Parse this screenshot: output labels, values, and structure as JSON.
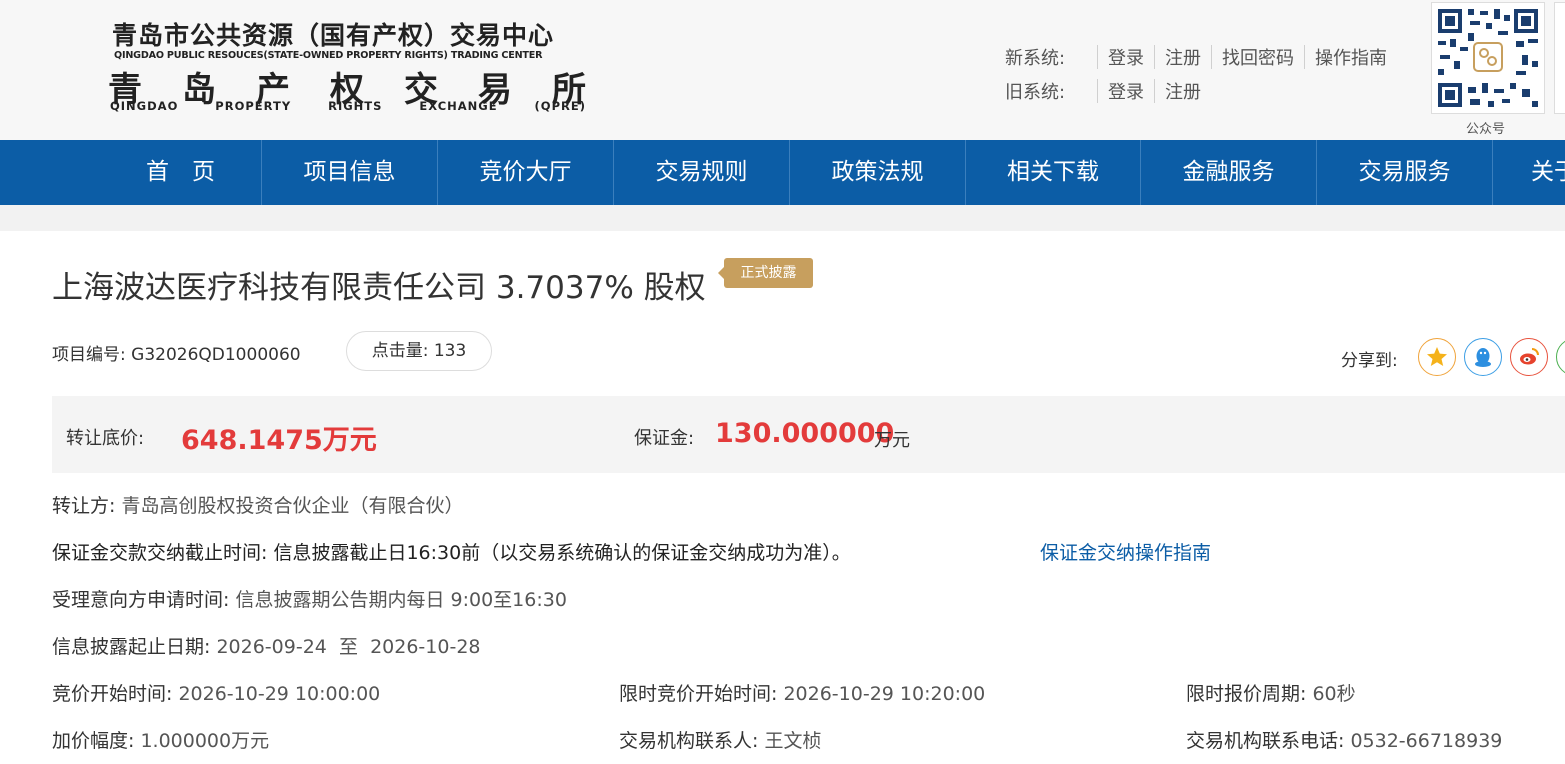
{
  "header": {
    "logo": {
      "name_zh": "青岛市公共资源（国有产权）交易中心",
      "name_en": "QINGDAO PUBLIC RESOUCES(STATE-OWNED PROPERTY RIGHTS) TRADING CENTER",
      "exchange_zh": [
        "青",
        "岛",
        "产",
        "权",
        "交",
        "易",
        "所"
      ],
      "exchange_en": [
        "QINGDAO",
        "PROPERTY",
        "RIGHTS",
        "EXCHANGE",
        "(QPRE)"
      ]
    },
    "new_system": {
      "label": "新系统:",
      "links": [
        "登录",
        "注册",
        "找回密码",
        "操作指南"
      ]
    },
    "old_system": {
      "label": "旧系统:",
      "links": [
        "登录",
        "注册"
      ]
    },
    "qr_caption": "公众号"
  },
  "nav": {
    "items": [
      "首　页",
      "项目信息",
      "竞价大厅",
      "交易规则",
      "政策法规",
      "相关下载",
      "金融服务",
      "交易服务",
      "关于"
    ]
  },
  "project": {
    "title": "上海波达医疗科技有限责任公司 3.7037% 股权",
    "badge": "正式披露",
    "number_label": "项目编号:",
    "number": "G32026QD1000060",
    "clicks_label": "点击量:",
    "clicks": "133",
    "share_label": "分享到:"
  },
  "price": {
    "base_label": "转让底价:",
    "base_value": "648.1475万元",
    "deposit_label": "保证金:",
    "deposit_value": "130.000000",
    "deposit_unit": "万元"
  },
  "details": {
    "transferor_label": "转让方:",
    "transferor": "青岛高创股权投资合伙企业（有限合伙）",
    "deposit_deadline_label": "保证金交款交纳截止时间:",
    "deposit_deadline": "信息披露截止日16:30前（以交易系统确认的保证金交纳成功为准）。",
    "deposit_guide_link": "保证金交纳操作指南",
    "apply_time_label": "受理意向方申请时间:",
    "apply_time": "信息披露期公告期内每日 9:00至16:30",
    "disclosure_label": "信息披露起止日期:",
    "disclosure_start": "2026-09-24",
    "disclosure_to": "至",
    "disclosure_end": "2026-10-28",
    "bid_start_label": "竞价开始时间:",
    "bid_start": "2026-10-29 10:00:00",
    "limited_bid_label": "限时竞价开始时间:",
    "limited_bid": "2026-10-29 10:20:00",
    "quote_cycle_label": "限时报价周期:",
    "quote_cycle": "60秒",
    "increment_label": "加价幅度:",
    "increment": "1.000000万元",
    "contact_label": "交易机构联系人:",
    "contact": "王文桢",
    "phone_label": "交易机构联系电话:",
    "phone": "0532-66718939"
  },
  "share_icons": [
    "qzone-star-icon",
    "qq-penguin-icon",
    "weibo-icon",
    "wechat-icon"
  ],
  "colors": {
    "nav_bg": "#0c5da6",
    "price_red": "#e33b3b",
    "badge": "#c79f5e",
    "link": "#0c5da6"
  }
}
